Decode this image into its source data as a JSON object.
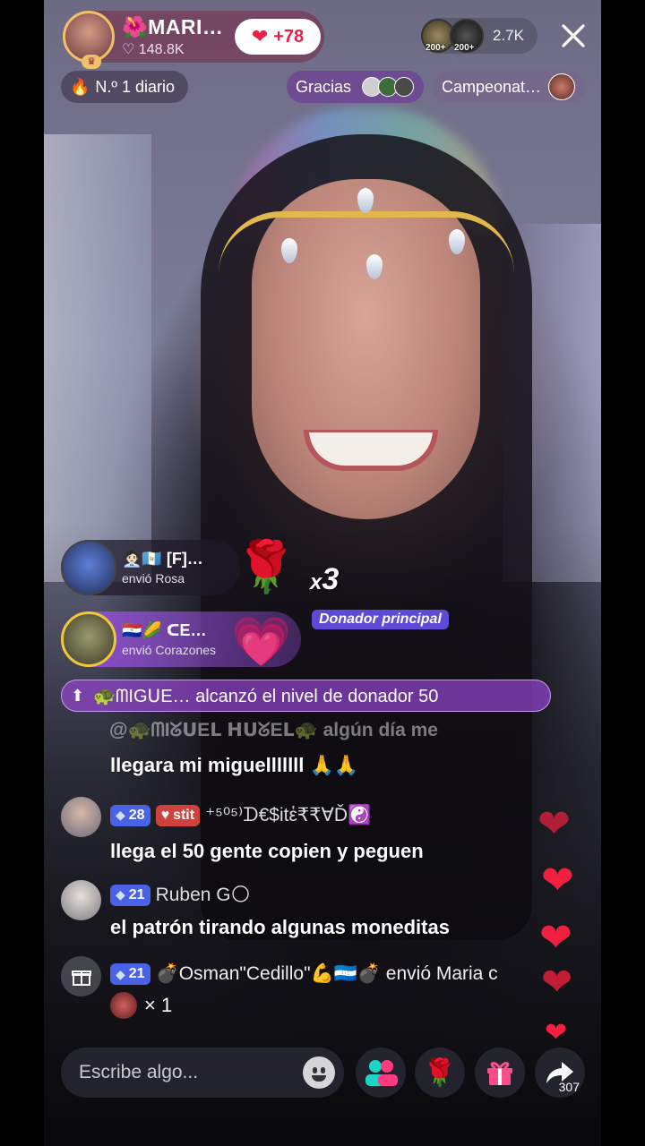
{
  "host": {
    "name": "MARI…",
    "likes": "148.8K",
    "follow_label": "+78"
  },
  "viewers": {
    "count": "2.7K",
    "badge_1": "200+",
    "badge_2": "200+"
  },
  "chips": {
    "rank": "N.º 1 diario",
    "thanks": "Gracias",
    "campaign": "Campeonat…"
  },
  "gifts": [
    {
      "user": "🧑🏻‍💼🇬🇹 [F]…",
      "sent": "envió Rosa",
      "gift_icon": "rose-icon"
    },
    {
      "user": "🇵🇾🌽 ᑕE…",
      "sent": "envió Corazones",
      "gift_icon": "heart-icon"
    }
  ],
  "combo": {
    "prefix": "x",
    "count": "3"
  },
  "top_donor_label": "Donador principal",
  "level_banner": "🐢ᗰIGᑌE… alcanzó el nivel de donador 50",
  "faded_comment": "@🐢ᗰIᘜᑌEᒪ ᕼᑌᘜEᒪ🐢 algún día me",
  "comments": [
    {
      "head": "",
      "text": "llegara mi miguelllllll 🙏🙏"
    },
    {
      "level": "28",
      "team": "stit",
      "user": "⁺⁵⁰⁵⁾ᗪ€$itἑ₹₹∀Ď☯️",
      "text": "llega el 50 gente copien y peguen"
    },
    {
      "level": "21",
      "user": "Ruben G🌕",
      "text": "el patrón tirando algunas moneditas"
    },
    {
      "level": "21",
      "user": "💣Osman\"Cedillo\"💪🇭🇳💣 envió Maria c",
      "text": "× 1"
    }
  ],
  "input": {
    "placeholder": "Escribe algo..."
  },
  "share_count": "307",
  "colors": {
    "accent": "#e8204a",
    "purple": "#9646d2",
    "badge_blue": "#4a62e6"
  }
}
